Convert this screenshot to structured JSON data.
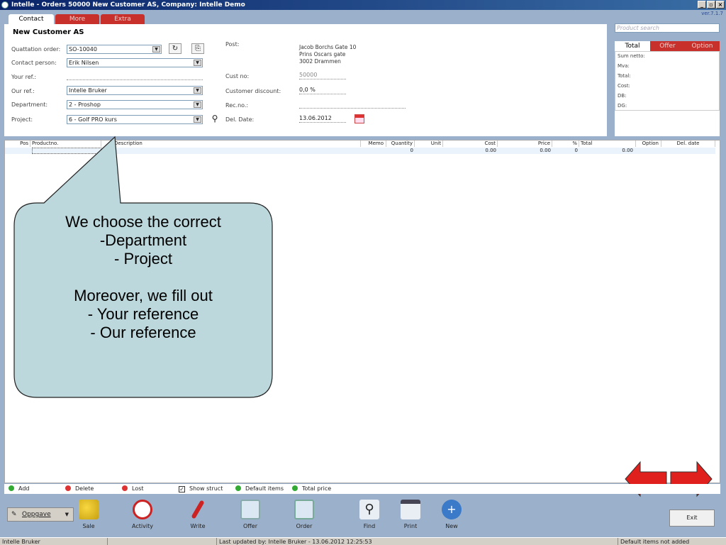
{
  "window": {
    "title": "Intelle - Orders  50000 New Customer AS,  Company: Intelle Demo",
    "version": "ver.7.1.7",
    "minimize": "_",
    "maximize": "▫",
    "close": "×"
  },
  "tabs": [
    {
      "label": "Contact",
      "color": "#ffffff"
    },
    {
      "label": "More",
      "color": "#c8302c"
    },
    {
      "label": "Extra",
      "color": "#c8302c"
    }
  ],
  "form": {
    "customer_name": "New Customer AS",
    "quotation_label": "Quattation order:",
    "quotation_value": "SO-10040",
    "contact_label": "Contact person:",
    "contact_value": "Erik Nilsen",
    "yourref_label": "Your ref.:",
    "yourref_value": "",
    "ourref_label": "Our ref.:",
    "ourref_value": "Intelle Bruker",
    "department_label": "Department:",
    "department_value": "2 - Proshop",
    "project_label": "Project:",
    "project_value": "6 - Golf PRO kurs",
    "post_label": "Post:",
    "post_line1": "Jacob Borchs Gate 10",
    "post_line2": "Prins Oscars gate",
    "post_line3": "3002 Drammen",
    "custno_label": "Cust no:",
    "custno_value": "50000",
    "discount_label": "Customer discount:",
    "discount_value": "0,0 %",
    "recno_label": "Rec.no.:",
    "recno_value": "",
    "deldate_label": "Del. Date:",
    "deldate_value": "13.06.2012"
  },
  "right_panel": {
    "search_placeholder": "Product search",
    "tabs": [
      {
        "label": "Total",
        "color": "#ffffff"
      },
      {
        "label": "Offer",
        "color": "#c8302c"
      },
      {
        "label": "Option",
        "color": "#c8302c"
      }
    ],
    "rows": [
      "Sum netto:",
      "Mva:",
      "Total:",
      "Cost:",
      "DB:",
      "DG:"
    ]
  },
  "grid": {
    "columns": [
      "Pos",
      "Productno.",
      "Description",
      "Memo",
      "Quantity",
      "Unit",
      "Cost",
      "Price",
      "%",
      "Total",
      "Option",
      "Del. date"
    ],
    "row": {
      "quantity": "0",
      "cost": "0.00",
      "price": "0.00",
      "percent": "0",
      "total": "0.00"
    }
  },
  "bottom_actions": {
    "add": "Add",
    "delete": "Delete",
    "lost": "Lost",
    "show_struct": "Show struct",
    "show_struct_checked": true,
    "default_items": "Default items",
    "total_price": "Total price"
  },
  "toolbar": {
    "dropdown": "Oppgave",
    "sale": "Sale",
    "activity": "Activity",
    "write": "Write",
    "offer": "Offer",
    "order": "Order",
    "find": "Find",
    "print": "Print",
    "new": "New",
    "exit": "Exit"
  },
  "status": {
    "user": "Intelle Bruker",
    "updated": "Last updated by: Intelle Bruker - 13.06.2012 12:25:53",
    "message": "Default items not added"
  },
  "callout": {
    "line1": "We choose the correct",
    "line2": "-Department",
    "line3": "- Project",
    "line4": "Moreover, we fill out",
    "line5": "- Your reference",
    "line6": "- Our reference"
  },
  "colors": {
    "accent_red": "#c8302c",
    "callout_fill": "#bcd8dc",
    "arrow_red": "#e0201c"
  }
}
